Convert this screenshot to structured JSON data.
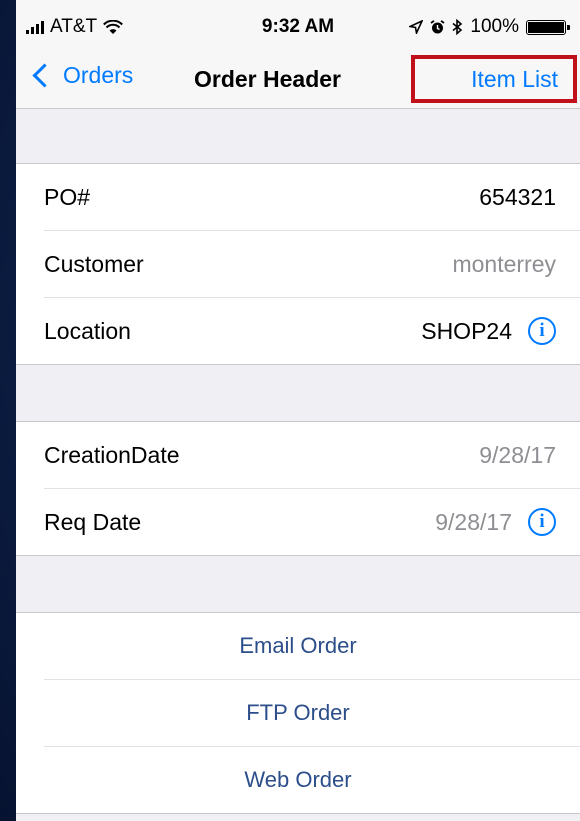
{
  "status_bar": {
    "carrier": "AT&T",
    "time": "9:32 AM",
    "battery_percent": "100%",
    "battery_level": 1.0
  },
  "nav": {
    "back_label": "Orders",
    "title": "Order Header",
    "right_label": "Item List"
  },
  "header_fields": [
    {
      "label": "PO#",
      "value": "654321"
    },
    {
      "label": "Customer",
      "value": "monterrey"
    },
    {
      "label": "Location",
      "value": "SHOP24"
    }
  ],
  "date_fields": [
    {
      "label": "CreationDate",
      "value": "9/28/17"
    },
    {
      "label": "Req Date",
      "value": "9/28/17"
    }
  ],
  "actions": [
    {
      "label": "Email Order"
    },
    {
      "label": "FTP Order"
    },
    {
      "label": "Web Order"
    }
  ],
  "colors": {
    "accent": "#007aff",
    "highlight": "#c0101a"
  },
  "icons": [
    "signal-bars-icon",
    "wifi-icon",
    "location-arrow-icon",
    "alarm-icon",
    "bluetooth-icon",
    "battery-icon",
    "chevron-left-icon",
    "info-icon"
  ]
}
